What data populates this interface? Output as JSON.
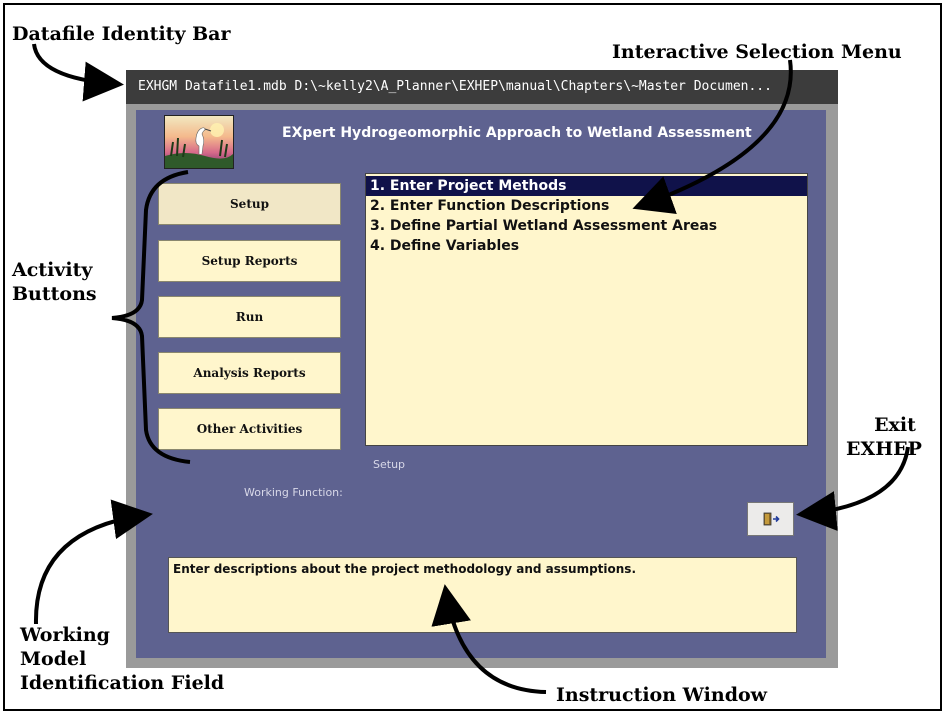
{
  "callouts": {
    "datafile_identity_bar": "Datafile Identity Bar",
    "interactive_selection_menu": "Interactive Selection Menu",
    "activity_buttons_line1": "Activity",
    "activity_buttons_line2": "Buttons",
    "exit_line1": "Exit",
    "exit_line2": "EXHEP",
    "working_model_line1": "Working",
    "working_model_line2": "Model",
    "working_model_line3": "Identification Field",
    "instruction_window": "Instruction Window"
  },
  "window": {
    "title_bar": "EXHGM   Datafile1.mdb   D:\\~kelly2\\A_Planner\\EXHEP\\manual\\Chapters\\~Master Documen..."
  },
  "app": {
    "title": "EXpert Hydrogeomorphic Approach to Wetland Assessment"
  },
  "activity_buttons": [
    {
      "label": "Setup"
    },
    {
      "label": "Setup Reports"
    },
    {
      "label": "Run"
    },
    {
      "label": "Analysis Reports"
    },
    {
      "label": "Other Activities"
    }
  ],
  "selection_menu": {
    "items": [
      {
        "label": "1. Enter Project Methods",
        "selected": true
      },
      {
        "label": "2. Enter Function Descriptions"
      },
      {
        "label": "3. Define Partial Wetland Assessment Areas"
      },
      {
        "label": "4. Define Variables"
      }
    ]
  },
  "status": {
    "activity": "Setup",
    "working_function_label": "Working Function:"
  },
  "instruction": {
    "text": "Enter descriptions about the project methodology and assumptions."
  },
  "colors": {
    "panel": "#5e6290",
    "button_face": "#fff6cc",
    "selection": "#10124a",
    "titlebar": "#3c3c3c"
  },
  "icons": {
    "logo": "heron-wetland-logo",
    "exit": "exit-door-icon"
  }
}
